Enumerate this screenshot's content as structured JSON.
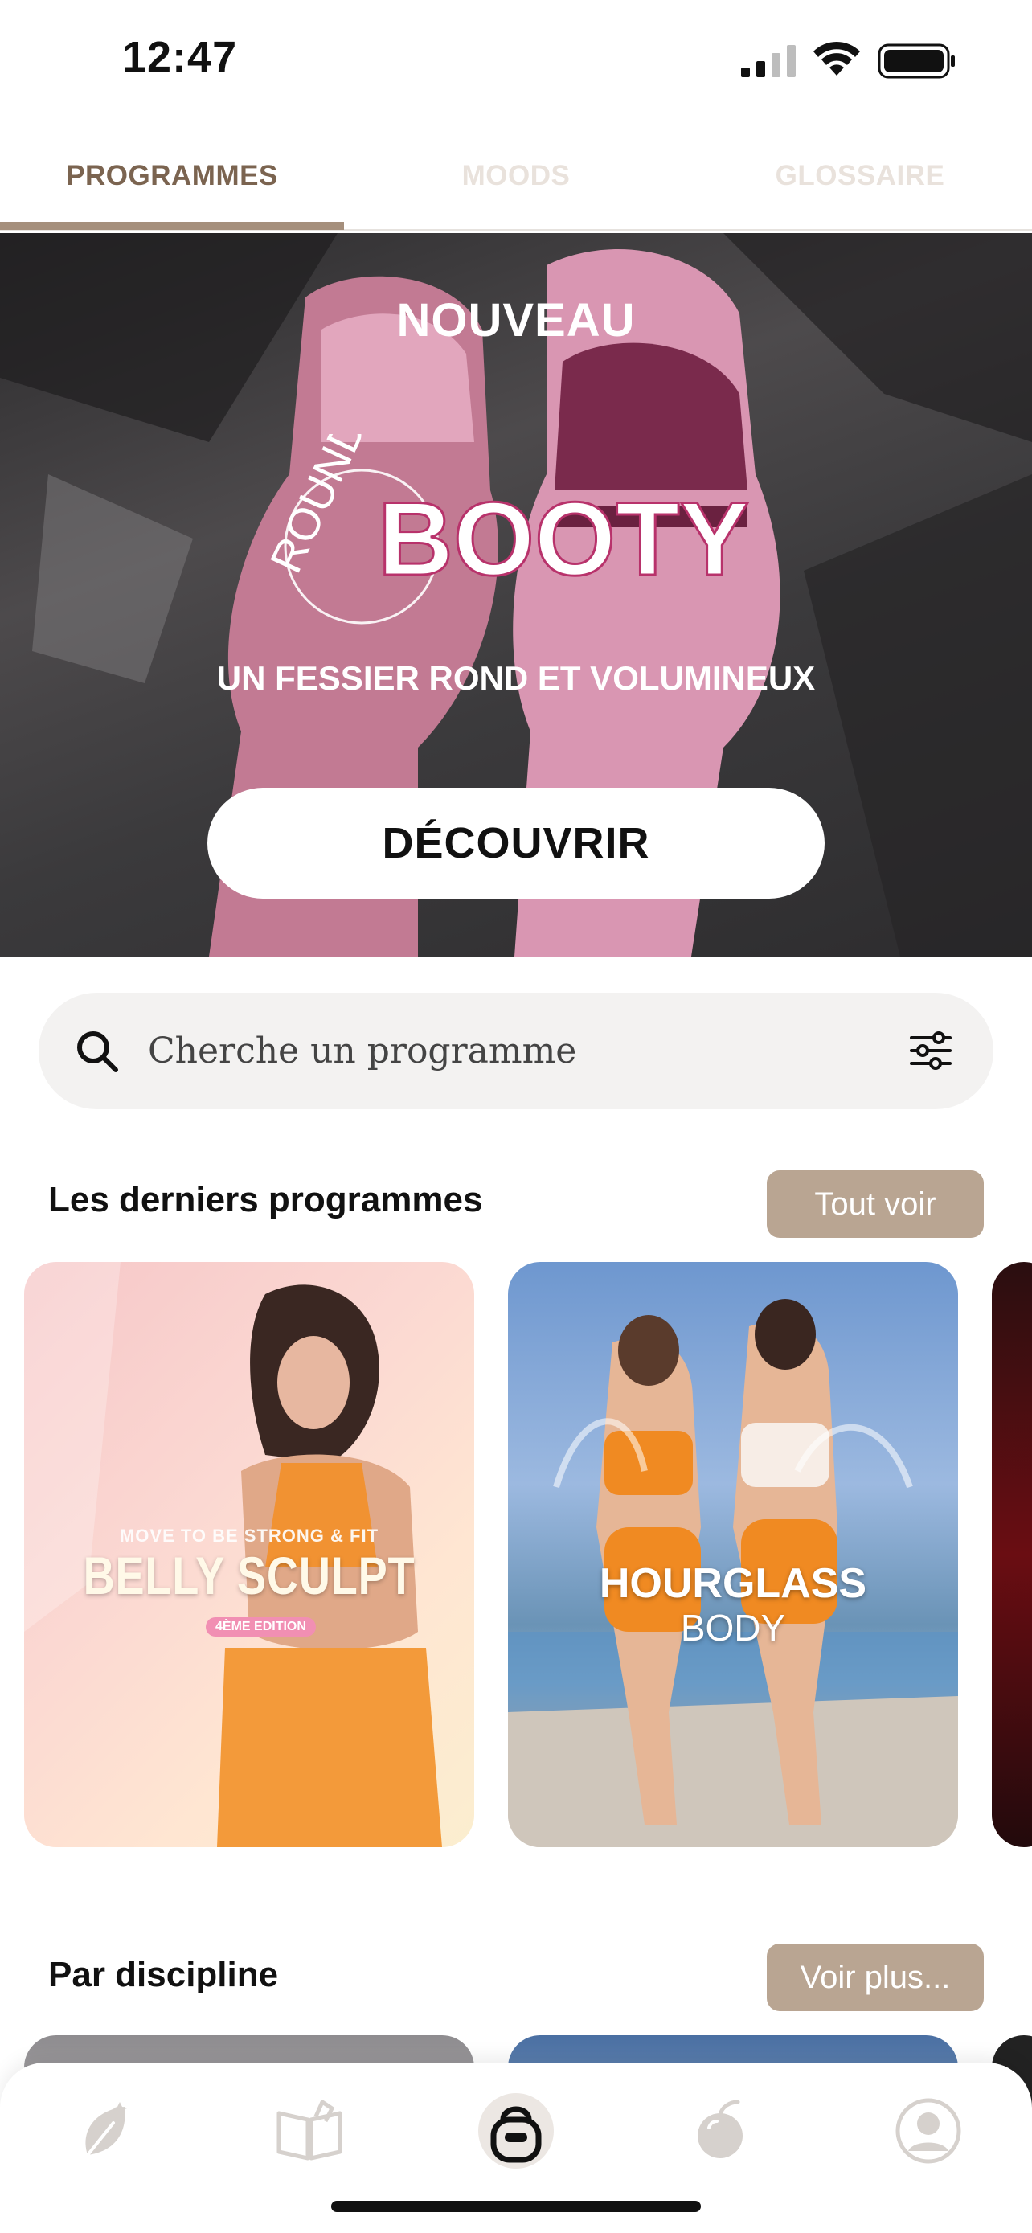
{
  "status_bar": {
    "time": "12:47"
  },
  "tabs": [
    {
      "label": "PROGRAMMES",
      "active": true
    },
    {
      "label": "MOODS",
      "active": false
    },
    {
      "label": "GLOSSAIRE",
      "active": false
    }
  ],
  "hero": {
    "badge": "NOUVEAU",
    "logo_round": "ROUND",
    "logo_booty": "BOOTY",
    "subtitle": "UN FESSIER ROND ET VOLUMINEUX",
    "cta_label": "DÉCOUVRIR"
  },
  "search": {
    "placeholder": "Cherche un programme"
  },
  "latest": {
    "title": "Les derniers programmes",
    "see_all_label": "Tout voir",
    "cards": [
      {
        "kicker": "MOVE TO BE STRONG & FIT",
        "title": "BELLY SCULPT",
        "edition": "4ÈME EDITION"
      },
      {
        "title": "HOURGLASS",
        "subtitle": "BODY"
      }
    ]
  },
  "discipline": {
    "title": "Par discipline",
    "see_more_label": "Voir plus..."
  },
  "bottom_nav": {
    "items": [
      {
        "icon": "leaf-icon",
        "active": false
      },
      {
        "icon": "book-icon",
        "active": false
      },
      {
        "icon": "kettlebell-icon",
        "active": true
      },
      {
        "icon": "apple-icon",
        "active": false
      },
      {
        "icon": "profile-icon",
        "active": false
      }
    ]
  },
  "colors": {
    "accent": "#a58f7c",
    "button": "#b9a592",
    "tab_active": "#7b6450",
    "tab_inactive": "#e9e2dc"
  }
}
